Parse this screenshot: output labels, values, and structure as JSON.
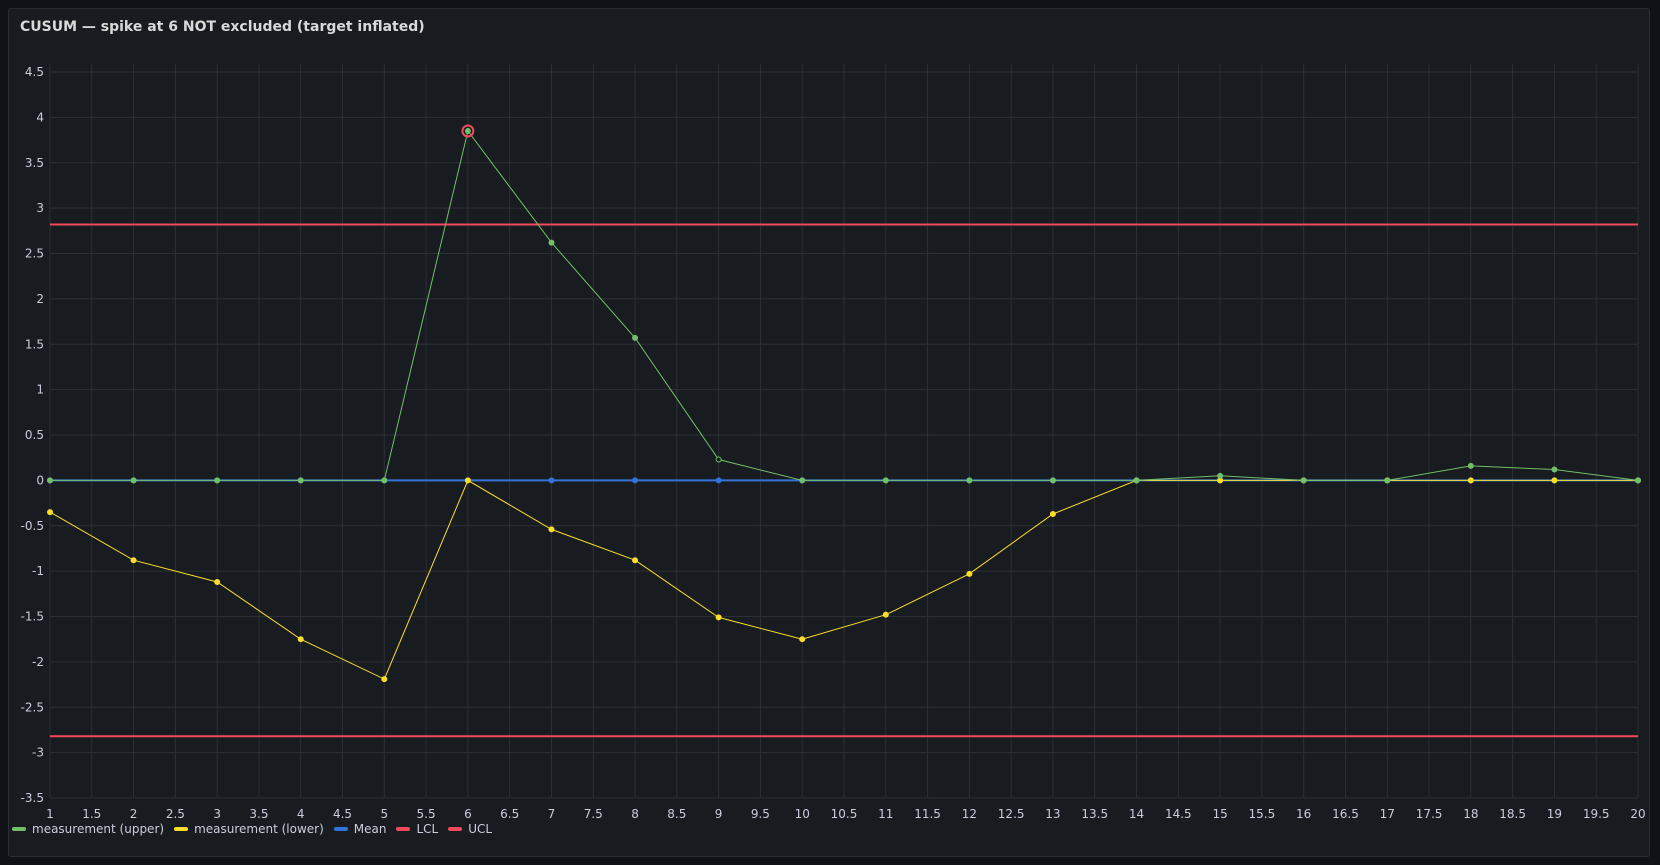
{
  "panel": {
    "title": "CUSUM — spike at 6 NOT excluded (target inflated)"
  },
  "colors": {
    "background": "#111217",
    "panel": "#181b1f",
    "grid": "#2c2f35",
    "text": "#ccccdc",
    "upper": "#73bf69",
    "lower": "#fade2a",
    "mean": "#3274d9",
    "limits": "#f2495c"
  },
  "chart_data": {
    "type": "line",
    "title": "CUSUM — spike at 6 NOT excluded (target inflated)",
    "xlabel": "",
    "ylabel": "",
    "xlim": [
      1,
      20
    ],
    "ylim": [
      -3.5,
      4.5
    ],
    "x_ticks": [
      "1",
      "1.5",
      "2",
      "2.5",
      "3",
      "3.5",
      "4",
      "4.5",
      "5",
      "5.5",
      "6",
      "6.5",
      "7",
      "7.5",
      "8",
      "8.5",
      "9",
      "9.5",
      "10",
      "10.5",
      "11",
      "11.5",
      "12",
      "12.5",
      "13",
      "13.5",
      "14",
      "14.5",
      "15",
      "15.5",
      "16",
      "16.5",
      "17",
      "17.5",
      "18",
      "18.5",
      "19",
      "19.5",
      "20"
    ],
    "y_ticks": [
      "4.5",
      "4",
      "3.5",
      "3",
      "2.5",
      "2",
      "1.5",
      "1",
      "0.5",
      "0",
      "-0.5",
      "-1",
      "-1.5",
      "-2",
      "-2.5",
      "-3",
      "-3.5"
    ],
    "grid": true,
    "legend_position": "bottom-left",
    "x": [
      1,
      2,
      3,
      4,
      5,
      6,
      7,
      8,
      9,
      10,
      11,
      12,
      13,
      14,
      15,
      16,
      17,
      18,
      19,
      20
    ],
    "series": [
      {
        "name": "measurement (upper)",
        "color": "#73bf69",
        "values": [
          0,
          0,
          0,
          0,
          0,
          3.85,
          2.62,
          1.57,
          0.23,
          0,
          0,
          0,
          0,
          0,
          0.05,
          0,
          0,
          0.16,
          0.12,
          0
        ]
      },
      {
        "name": "measurement (lower)",
        "color": "#fade2a",
        "values": [
          -0.35,
          -0.88,
          -1.12,
          -1.75,
          -2.19,
          0,
          -0.54,
          -0.88,
          -1.51,
          -1.75,
          -1.48,
          -1.03,
          -0.37,
          0,
          0,
          0,
          0,
          0,
          0,
          0
        ]
      },
      {
        "name": "Mean",
        "color": "#3274d9",
        "values": [
          0,
          0,
          0,
          0,
          0,
          0,
          0,
          0,
          0,
          0,
          0,
          0,
          0,
          0,
          0,
          0,
          0,
          0,
          0,
          0
        ]
      },
      {
        "name": "LCL",
        "color": "#f2495c",
        "values": [
          -2.82,
          -2.82,
          -2.82,
          -2.82,
          -2.82,
          -2.82,
          -2.82,
          -2.82,
          -2.82,
          -2.82,
          -2.82,
          -2.82,
          -2.82,
          -2.82,
          -2.82,
          -2.82,
          -2.82,
          -2.82,
          -2.82,
          -2.82
        ]
      },
      {
        "name": "UCL",
        "color": "#f2495c",
        "values": [
          2.82,
          2.82,
          2.82,
          2.82,
          2.82,
          2.82,
          2.82,
          2.82,
          2.82,
          2.82,
          2.82,
          2.82,
          2.82,
          2.82,
          2.82,
          2.82,
          2.82,
          2.82,
          2.82,
          2.82
        ]
      }
    ],
    "highlighted_points": [
      {
        "series": "measurement (upper)",
        "x": 6,
        "y": 3.85
      }
    ],
    "hollow_points": [
      {
        "series": "measurement (upper)",
        "x": 9,
        "y": 0.23
      }
    ]
  }
}
